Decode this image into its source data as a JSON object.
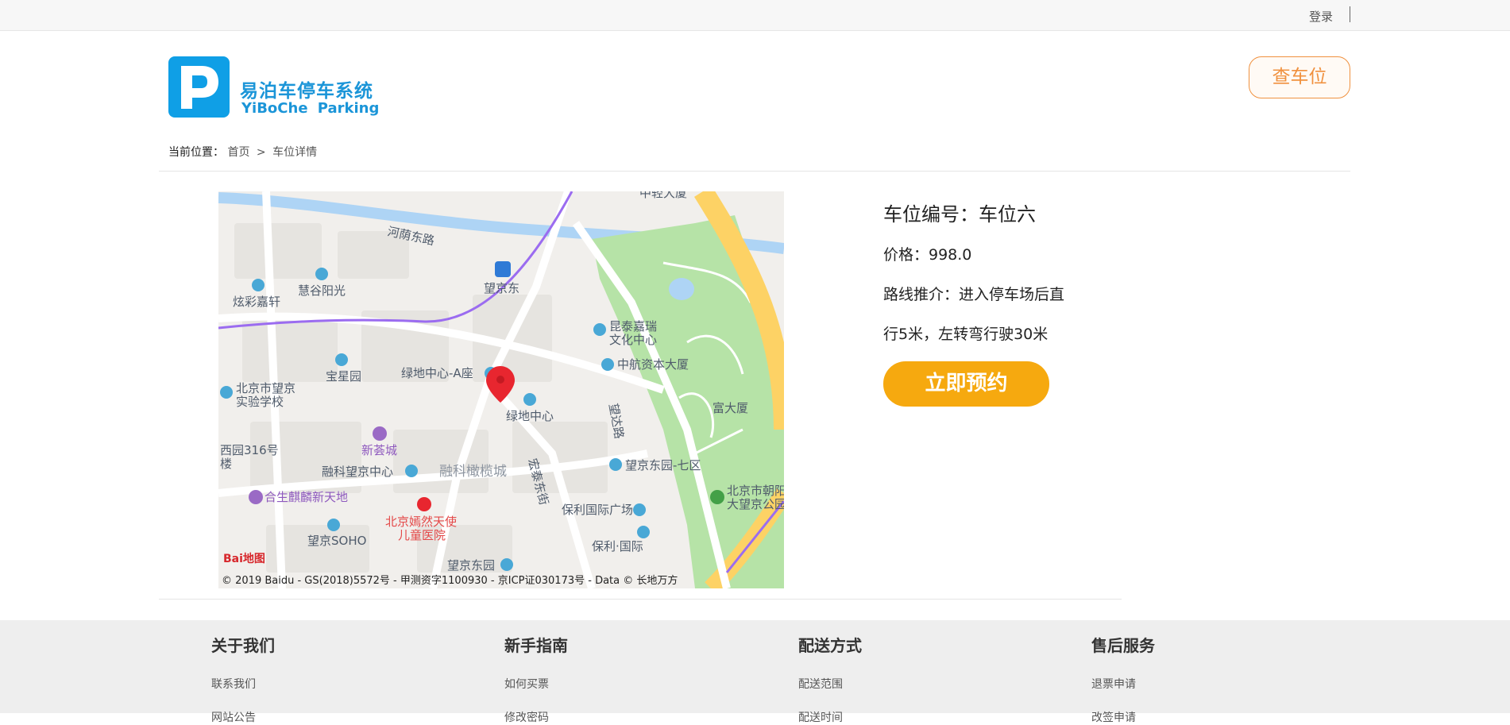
{
  "topbar": {
    "login": "登录"
  },
  "logo": {
    "cn": "易泊车停车系统",
    "en": "YiBoChe Parking",
    "mark": "P"
  },
  "header": {
    "find_button": "查车位"
  },
  "breadcrumb": {
    "label": "当前位置：",
    "home": "首页",
    "arrow": ">",
    "current": "车位详情"
  },
  "map": {
    "labels": {
      "l1": "河荫东路",
      "l2": "望京东",
      "l3": "慧谷阳光",
      "l4": "炫彩嘉轩",
      "l5": "昆泰嘉瑞",
      "l6": "文化中心",
      "l7": "中航资本大厦",
      "l8": "宝星园",
      "l9": "绿地中心-A座",
      "l10": "北京市望京",
      "l11": "实验学校",
      "l12": "绿地中心",
      "l13": "望达路",
      "l14": "富大厦",
      "l15": "西园316号",
      "l16": "楼",
      "l17": "新荟城",
      "l18": "融科望京中心",
      "l19": "融科橄榄城",
      "l20": "宏泰东街",
      "l21": "望京东园-七区",
      "l22": "北京市朝阳",
      "l23": "大望京公园",
      "l24": "合生麒麟新天地",
      "l25": "北京嫣然天使",
      "l26": "儿童医院",
      "l27": "保利国际广场",
      "l28": "望京SOHO",
      "l29": "保利·国际",
      "l30": "望京东园",
      "l31": "中轻大厦"
    },
    "baidu_logo": "Bai地图",
    "copyright": "© 2019 Baidu - GS(2018)5572号 - 甲测资字1100930 - 京ICP证030173号 - Data © 长地万方",
    "colors": {
      "park": "#b6e3a7",
      "road_yellow": "#fdd265",
      "river": "#aed4f5",
      "metro": "#9b6cf0",
      "pin": "#e8262f"
    }
  },
  "detail": {
    "title": "车位编号：车位六",
    "price": "价格：998.0",
    "route_line1": "路线推介：进入停车场后直",
    "route_line2": "行5米，左转弯行驶30米",
    "book_button": "立即预约"
  },
  "footer": {
    "cols": [
      {
        "title": "关于我们",
        "links": [
          "联系我们",
          "网站公告"
        ]
      },
      {
        "title": "新手指南",
        "links": [
          "如何买票",
          "修改密码"
        ]
      },
      {
        "title": "配送方式",
        "links": [
          "配送范围",
          "配送时间"
        ]
      },
      {
        "title": "售后服务",
        "links": [
          "退票申请",
          "改签申请"
        ]
      }
    ]
  }
}
